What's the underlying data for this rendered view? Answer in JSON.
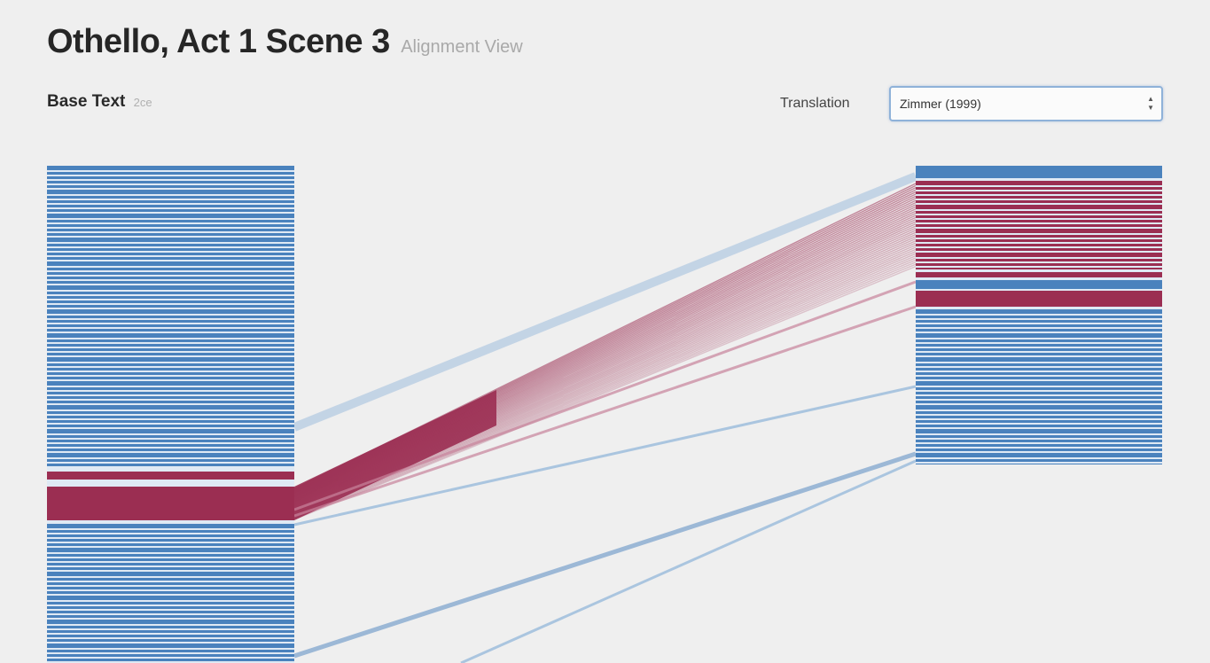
{
  "header": {
    "title": "Othello, Act 1 Scene 3",
    "subtitle": "Alignment View"
  },
  "base_text": {
    "label": "Base Text",
    "meta": "2ce"
  },
  "translation": {
    "label": "Translation",
    "selected": "Zimmer (1999)",
    "arrow_up": "▲",
    "arrow_down": "▼"
  },
  "colors": {
    "blue": "#4a82bd",
    "blue_light": "#8db4d9",
    "red": "#9b2e52",
    "red_light": "#c7839b",
    "background": "#efefef"
  }
}
